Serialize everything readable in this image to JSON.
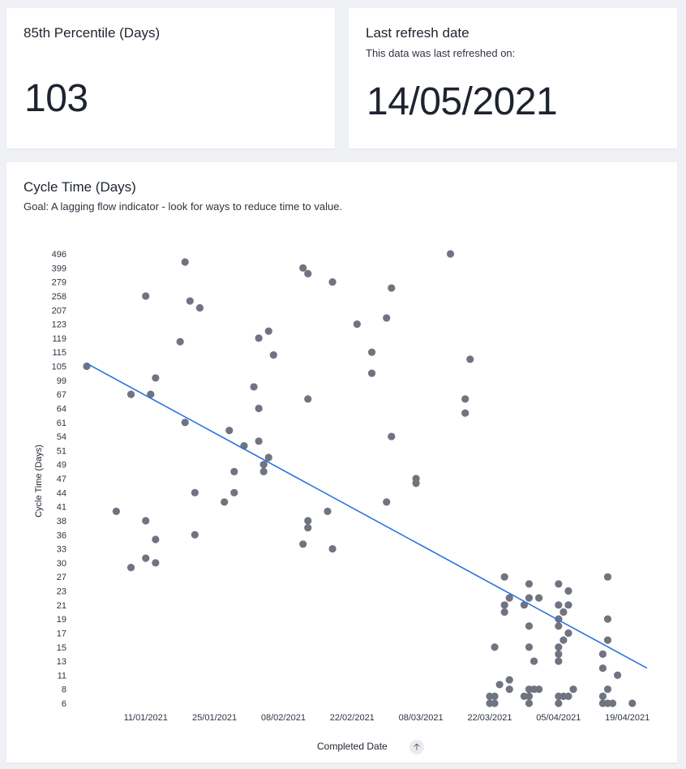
{
  "kpi": {
    "title": "85th Percentile (Days)",
    "value": "103"
  },
  "refresh": {
    "title": "Last refresh date",
    "subtitle": "This data was last refreshed on:",
    "value": "14/05/2021"
  },
  "chart_card": {
    "title": "Cycle Time (Days)",
    "subtitle": "Goal: A lagging flow indicator - look for ways to reduce time to value.",
    "sort_icon": "arrow-up-icon",
    "sort_glyph": "🡡"
  },
  "colors": {
    "point": "#6f7480",
    "trend": "#2e74df"
  },
  "chart_data": {
    "type": "scatter",
    "title": "",
    "xlabel": "Completed Date",
    "ylabel": "Cycle Time (Days)",
    "xlim": [
      "2020-12-30",
      "2021-04-24"
    ],
    "x_ticks": [
      {
        "date": "2021-01-11",
        "label": "11/01/2021"
      },
      {
        "date": "2021-01-25",
        "label": "25/01/2021"
      },
      {
        "date": "2021-02-08",
        "label": "08/02/2021"
      },
      {
        "date": "2021-02-22",
        "label": "22/02/2021"
      },
      {
        "date": "2021-03-08",
        "label": "08/03/2021"
      },
      {
        "date": "2021-03-22",
        "label": "22/03/2021"
      },
      {
        "date": "2021-04-05",
        "label": "05/04/2021"
      },
      {
        "date": "2021-04-19",
        "label": "19/04/2021"
      }
    ],
    "y_categories": [
      6,
      8,
      11,
      13,
      15,
      17,
      19,
      21,
      23,
      27,
      30,
      33,
      36,
      38,
      41,
      44,
      47,
      49,
      51,
      54,
      61,
      64,
      67,
      99,
      105,
      115,
      119,
      123,
      207,
      258,
      279,
      399,
      496
    ],
    "grid": false,
    "trend_line": {
      "start": {
        "x": "2020-12-30",
        "y": 107
      },
      "end": {
        "x": "2021-04-23",
        "y": 12
      }
    },
    "points": [
      {
        "x": "2020-12-30",
        "y": 105
      },
      {
        "x": "2021-01-05",
        "y": 40
      },
      {
        "x": "2021-01-08",
        "y": 29
      },
      {
        "x": "2021-01-08",
        "y": 67
      },
      {
        "x": "2021-01-11",
        "y": 258
      },
      {
        "x": "2021-01-11",
        "y": 38
      },
      {
        "x": "2021-01-11",
        "y": 31
      },
      {
        "x": "2021-01-12",
        "y": 67
      },
      {
        "x": "2021-01-13",
        "y": 100
      },
      {
        "x": "2021-01-13",
        "y": 35
      },
      {
        "x": "2021-01-13",
        "y": 30
      },
      {
        "x": "2021-01-18",
        "y": 118
      },
      {
        "x": "2021-01-19",
        "y": 440
      },
      {
        "x": "2021-01-19",
        "y": 61
      },
      {
        "x": "2021-01-20",
        "y": 240
      },
      {
        "x": "2021-01-21",
        "y": 44
      },
      {
        "x": "2021-01-21",
        "y": 36
      },
      {
        "x": "2021-01-22",
        "y": 215
      },
      {
        "x": "2021-01-27",
        "y": 42
      },
      {
        "x": "2021-01-28",
        "y": 57
      },
      {
        "x": "2021-01-29",
        "y": 48
      },
      {
        "x": "2021-01-29",
        "y": 44
      },
      {
        "x": "2021-01-31",
        "y": 52
      },
      {
        "x": "2021-02-02",
        "y": 84
      },
      {
        "x": "2021-02-03",
        "y": 119
      },
      {
        "x": "2021-02-03",
        "y": 64
      },
      {
        "x": "2021-02-03",
        "y": 53
      },
      {
        "x": "2021-02-04",
        "y": 49
      },
      {
        "x": "2021-02-04",
        "y": 48
      },
      {
        "x": "2021-02-05",
        "y": 121
      },
      {
        "x": "2021-02-05",
        "y": 50
      },
      {
        "x": "2021-02-06",
        "y": 113
      },
      {
        "x": "2021-02-12",
        "y": 399
      },
      {
        "x": "2021-02-12",
        "y": 34
      },
      {
        "x": "2021-02-13",
        "y": 350
      },
      {
        "x": "2021-02-13",
        "y": 66
      },
      {
        "x": "2021-02-13",
        "y": 38
      },
      {
        "x": "2021-02-13",
        "y": 37
      },
      {
        "x": "2021-02-17",
        "y": 40
      },
      {
        "x": "2021-02-18",
        "y": 279
      },
      {
        "x": "2021-02-18",
        "y": 33
      },
      {
        "x": "2021-02-23",
        "y": 123
      },
      {
        "x": "2021-02-26",
        "y": 115
      },
      {
        "x": "2021-02-26",
        "y": 102
      },
      {
        "x": "2021-03-01",
        "y": 160
      },
      {
        "x": "2021-03-01",
        "y": 42
      },
      {
        "x": "2021-03-02",
        "y": 270
      },
      {
        "x": "2021-03-02",
        "y": 54
      },
      {
        "x": "2021-03-07",
        "y": 47
      },
      {
        "x": "2021-03-07",
        "y": 46
      },
      {
        "x": "2021-03-14",
        "y": 496
      },
      {
        "x": "2021-03-17",
        "y": 66
      },
      {
        "x": "2021-03-17",
        "y": 63
      },
      {
        "x": "2021-03-18",
        "y": 110
      },
      {
        "x": "2021-03-22",
        "y": 7
      },
      {
        "x": "2021-03-22",
        "y": 6
      },
      {
        "x": "2021-03-23",
        "y": 15
      },
      {
        "x": "2021-03-23",
        "y": 7
      },
      {
        "x": "2021-03-23",
        "y": 6
      },
      {
        "x": "2021-03-24",
        "y": 9
      },
      {
        "x": "2021-03-25",
        "y": 27
      },
      {
        "x": "2021-03-25",
        "y": 21
      },
      {
        "x": "2021-03-25",
        "y": 20
      },
      {
        "x": "2021-03-26",
        "y": 22
      },
      {
        "x": "2021-03-26",
        "y": 10
      },
      {
        "x": "2021-03-26",
        "y": 8
      },
      {
        "x": "2021-03-29",
        "y": 21
      },
      {
        "x": "2021-03-29",
        "y": 7
      },
      {
        "x": "2021-03-30",
        "y": 25
      },
      {
        "x": "2021-03-30",
        "y": 22
      },
      {
        "x": "2021-03-30",
        "y": 18
      },
      {
        "x": "2021-03-30",
        "y": 15
      },
      {
        "x": "2021-03-30",
        "y": 8
      },
      {
        "x": "2021-03-30",
        "y": 7
      },
      {
        "x": "2021-03-30",
        "y": 6
      },
      {
        "x": "2021-03-31",
        "y": 13
      },
      {
        "x": "2021-03-31",
        "y": 8
      },
      {
        "x": "2021-04-01",
        "y": 22
      },
      {
        "x": "2021-04-01",
        "y": 8
      },
      {
        "x": "2021-04-05",
        "y": 25
      },
      {
        "x": "2021-04-05",
        "y": 21
      },
      {
        "x": "2021-04-05",
        "y": 19
      },
      {
        "x": "2021-04-05",
        "y": 18
      },
      {
        "x": "2021-04-05",
        "y": 15
      },
      {
        "x": "2021-04-05",
        "y": 14
      },
      {
        "x": "2021-04-05",
        "y": 13
      },
      {
        "x": "2021-04-05",
        "y": 7
      },
      {
        "x": "2021-04-05",
        "y": 6
      },
      {
        "x": "2021-04-06",
        "y": 20
      },
      {
        "x": "2021-04-06",
        "y": 16
      },
      {
        "x": "2021-04-06",
        "y": 7
      },
      {
        "x": "2021-04-07",
        "y": 23
      },
      {
        "x": "2021-04-07",
        "y": 21
      },
      {
        "x": "2021-04-07",
        "y": 17
      },
      {
        "x": "2021-04-07",
        "y": 7
      },
      {
        "x": "2021-04-08",
        "y": 8
      },
      {
        "x": "2021-04-14",
        "y": 7
      },
      {
        "x": "2021-04-14",
        "y": 6
      },
      {
        "x": "2021-04-14",
        "y": 14
      },
      {
        "x": "2021-04-14",
        "y": 12
      },
      {
        "x": "2021-04-15",
        "y": 27
      },
      {
        "x": "2021-04-15",
        "y": 19
      },
      {
        "x": "2021-04-15",
        "y": 16
      },
      {
        "x": "2021-04-15",
        "y": 8
      },
      {
        "x": "2021-04-15",
        "y": 6
      },
      {
        "x": "2021-04-16",
        "y": 6
      },
      {
        "x": "2021-04-17",
        "y": 11
      },
      {
        "x": "2021-04-20",
        "y": 6
      }
    ]
  }
}
